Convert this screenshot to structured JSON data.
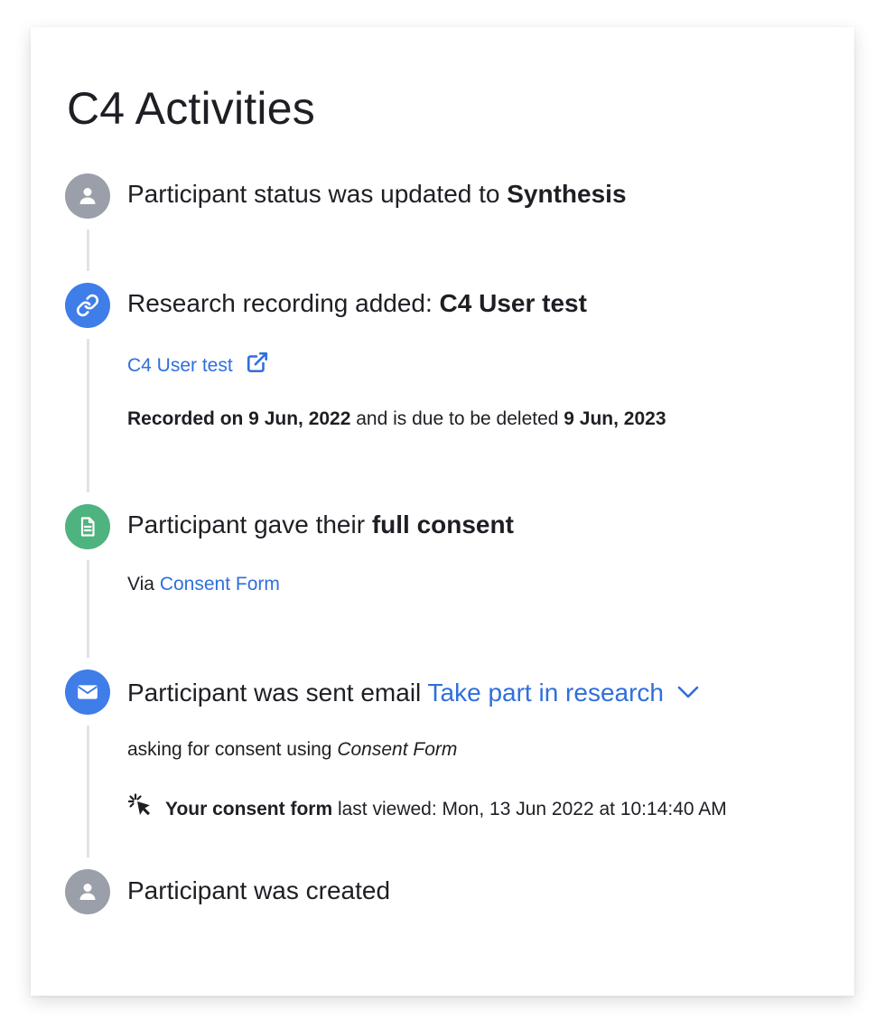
{
  "page": {
    "title": "C4 Activities"
  },
  "activities": [
    {
      "icon": "user-icon",
      "prefix": "Participant status was updated to ",
      "emphasis": "Synthesis"
    },
    {
      "icon": "link-icon",
      "prefix": "Research recording added: ",
      "emphasis": "C4 User test",
      "link_label": "C4 User test",
      "link_icon": "external-link-icon",
      "recorded_label": "Recorded on 9 Jun, 2022",
      "recorded_middle": " and is due to be deleted ",
      "delete_date": "9 Jun, 2023"
    },
    {
      "icon": "document-icon",
      "prefix": "Participant gave their ",
      "emphasis": "full consent",
      "via_label": "Via ",
      "via_link": "Consent Form"
    },
    {
      "icon": "envelope-icon",
      "prefix": "Participant was sent email ",
      "email_link": "Take part in research",
      "dropdown_icon": "chevron-down-icon",
      "detail_prefix": "asking for consent using ",
      "detail_form": "Consent Form",
      "viewed_icon": "cursor-click-icon",
      "viewed_bold": "Your consent form",
      "viewed_text": " last viewed: Mon, 13 Jun 2022 at 10:14:40 AM"
    },
    {
      "icon": "user-icon",
      "prefix": "Participant was created"
    }
  ],
  "colors": {
    "link": "#2f6fdd",
    "icon_grey": "#9a9fa9",
    "icon_blue": "#3f7de8",
    "icon_green": "#4eb37e",
    "timeline": "#e1e3e7"
  }
}
